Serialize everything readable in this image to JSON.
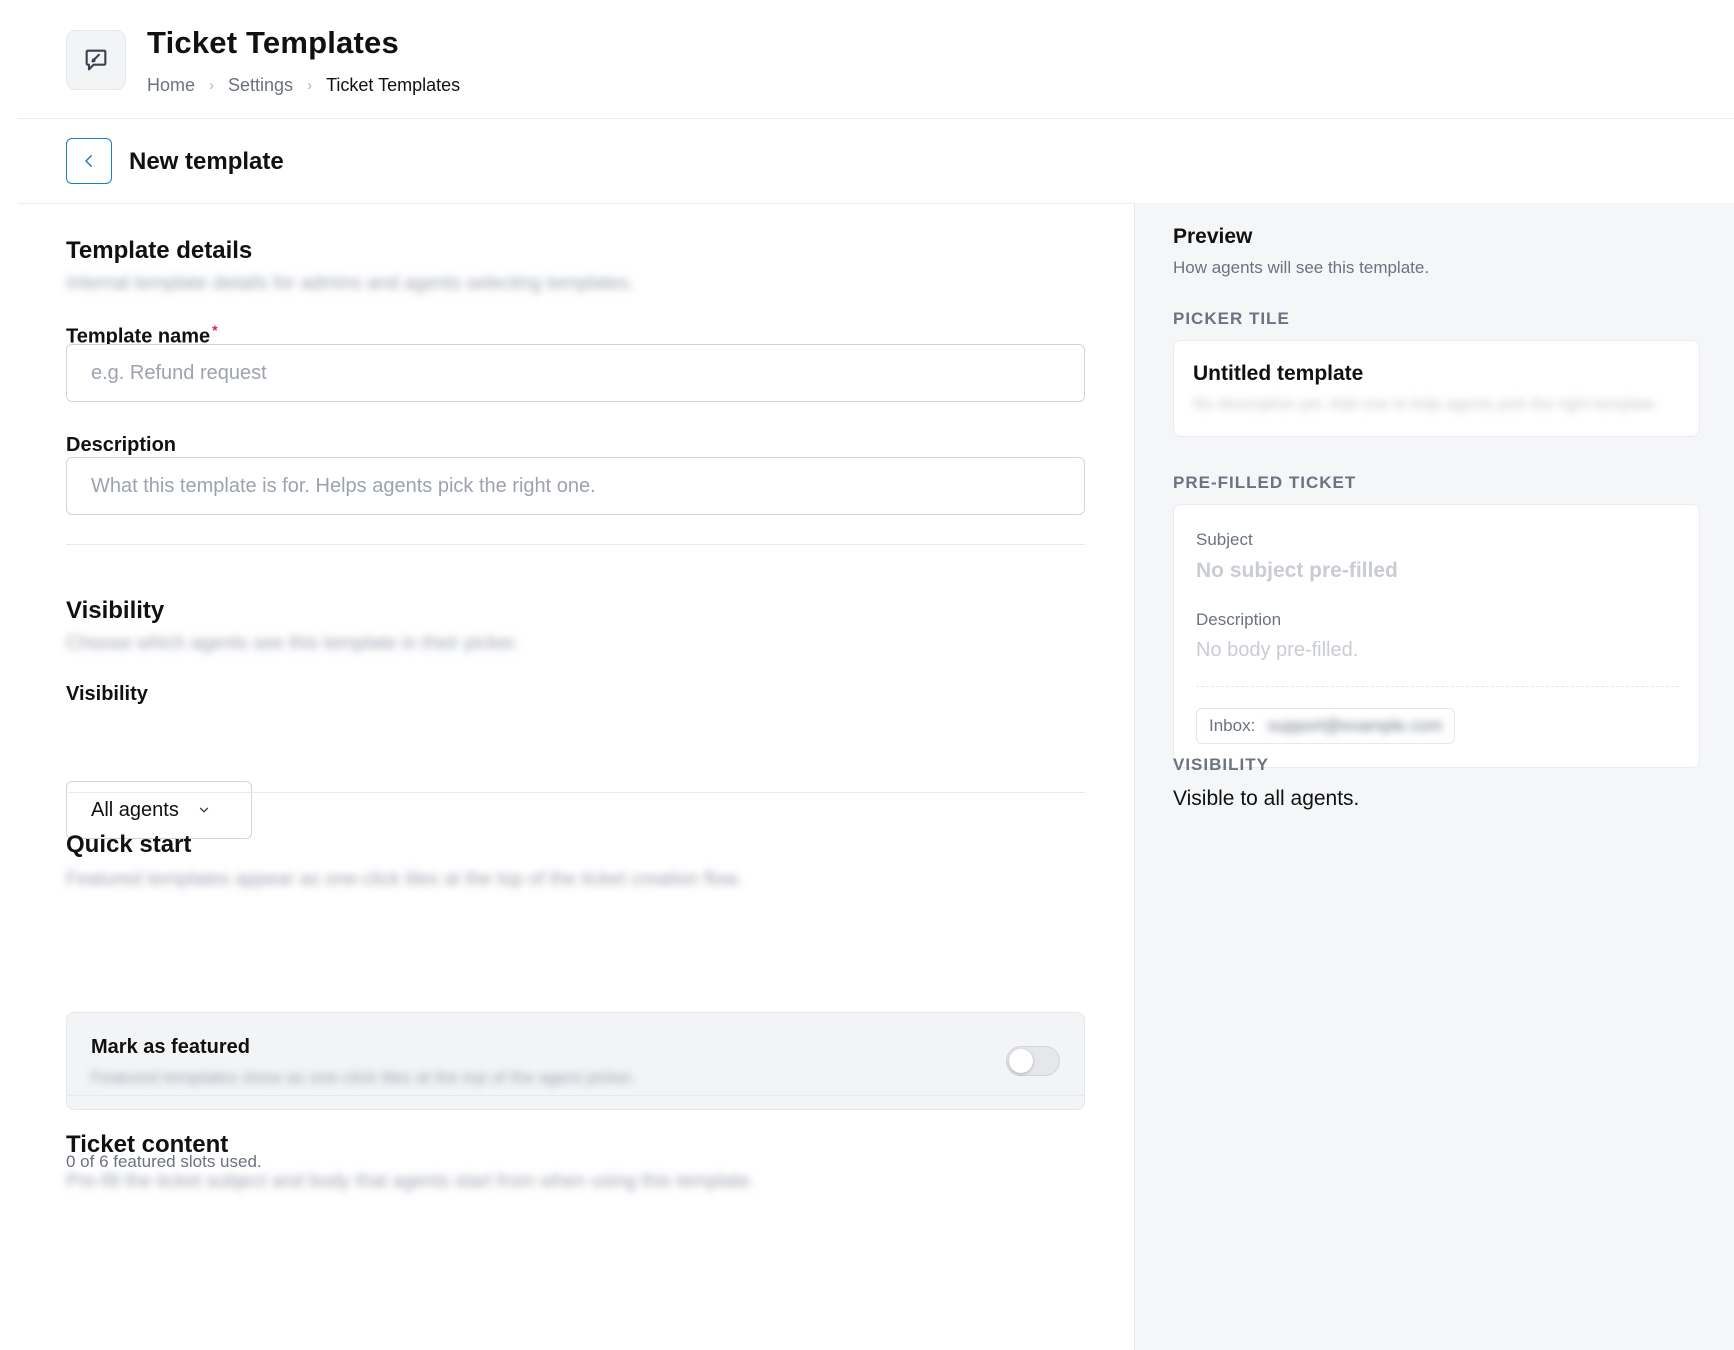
{
  "header": {
    "title": "Ticket Templates",
    "icon": "chat-edit-icon",
    "breadcrumb": [
      "Home",
      "Settings",
      "Ticket Templates"
    ]
  },
  "subheader": {
    "title": "New template",
    "back_icon": "chevron-left-icon"
  },
  "form": {
    "details": {
      "title": "Template details",
      "subtitle_blurred": "Internal template details for admins and agents selecting templates.",
      "name_label": "Template name",
      "name_value": "",
      "name_placeholder": "e.g. Refund request",
      "description_label": "Description",
      "description_value": "",
      "description_placeholder": "What this template is for. Helps agents pick the right one."
    },
    "visibility": {
      "title": "Visibility",
      "subtitle_blurred": "Choose which agents see this template in their picker.",
      "field_label": "Visibility",
      "selected": "All agents"
    },
    "quick_start": {
      "title": "Quick start",
      "subtitle_blurred": "Featured templates appear as one-click tiles at the top of the ticket creation flow.",
      "featured_label": "Mark as featured",
      "featured_desc_blurred": "Featured templates show as one-click tiles at the top of the agent picker.",
      "featured_on": false,
      "slots_text": "0 of 6 featured slots used."
    },
    "ticket_content": {
      "title": "Ticket content",
      "subtitle_blurred": "Pre-fill the ticket subject and body that agents start from when using this template."
    }
  },
  "preview": {
    "title": "Preview",
    "subtitle": "How agents will see this template.",
    "picker_tile_heading": "PICKER TILE",
    "tile_title": "Untitled template",
    "tile_desc_blurred": "No description yet. Add one to help agents pick the right template.",
    "prefilled_heading": "PRE-FILLED TICKET",
    "subject_label": "Subject",
    "subject_empty": "No subject pre-filled",
    "description_label": "Description",
    "description_empty": "No body pre-filled.",
    "inbox_label": "Inbox:",
    "inbox_value_blurred": "support@example.com",
    "visibility_heading": "VISIBILITY",
    "visibility_text": "Visible to all agents."
  },
  "colors": {
    "accent": "#1d7fc4",
    "required": "#e11d48",
    "preview_bg": "#f5f6f8"
  }
}
